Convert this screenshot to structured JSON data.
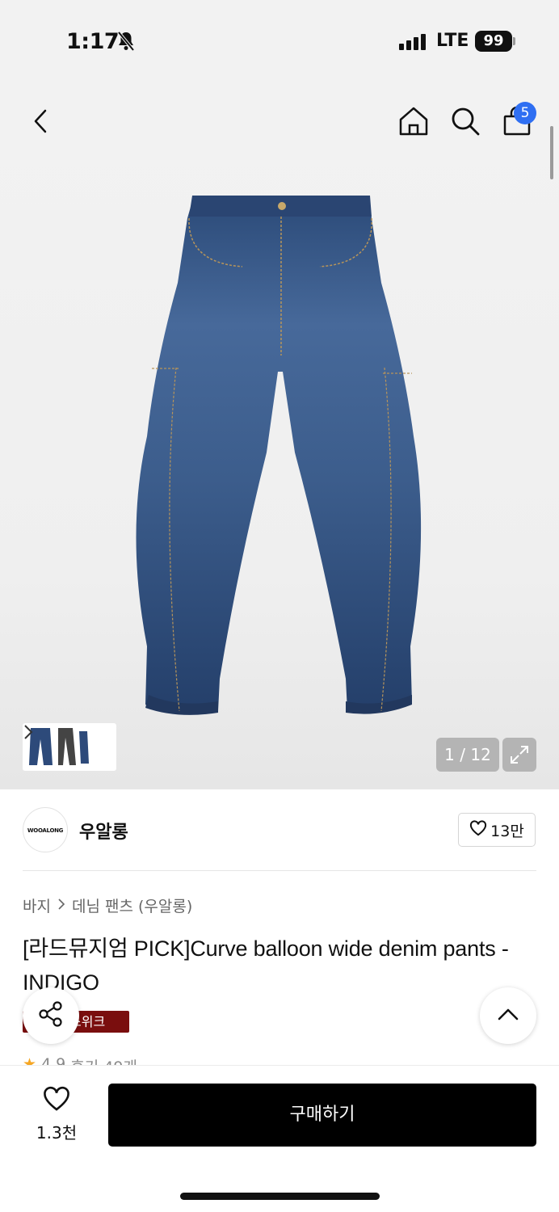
{
  "status_bar": {
    "time": "1:17",
    "network": "LTE",
    "battery": "99"
  },
  "header": {
    "cart_count": "5"
  },
  "gallery": {
    "counter": "1 / 12"
  },
  "brand": {
    "logo_text": "WOOALONG",
    "name": "우알롱",
    "followers": "13만"
  },
  "breadcrumb": {
    "level1": "바지",
    "level2": "데님 팬츠 (우알롱)"
  },
  "product": {
    "title": "[라드뮤지엄 PICK]Curve balloon wide denim pants - INDIGO",
    "tag": "스위크",
    "rating": "4.9",
    "reviews": "후기 49개"
  },
  "bottom": {
    "like_count": "1.3천",
    "buy_label": "구매하기"
  },
  "colors": {
    "accent": "#2f6ff2",
    "tag": "#7a0e0e",
    "button": "#000000"
  }
}
